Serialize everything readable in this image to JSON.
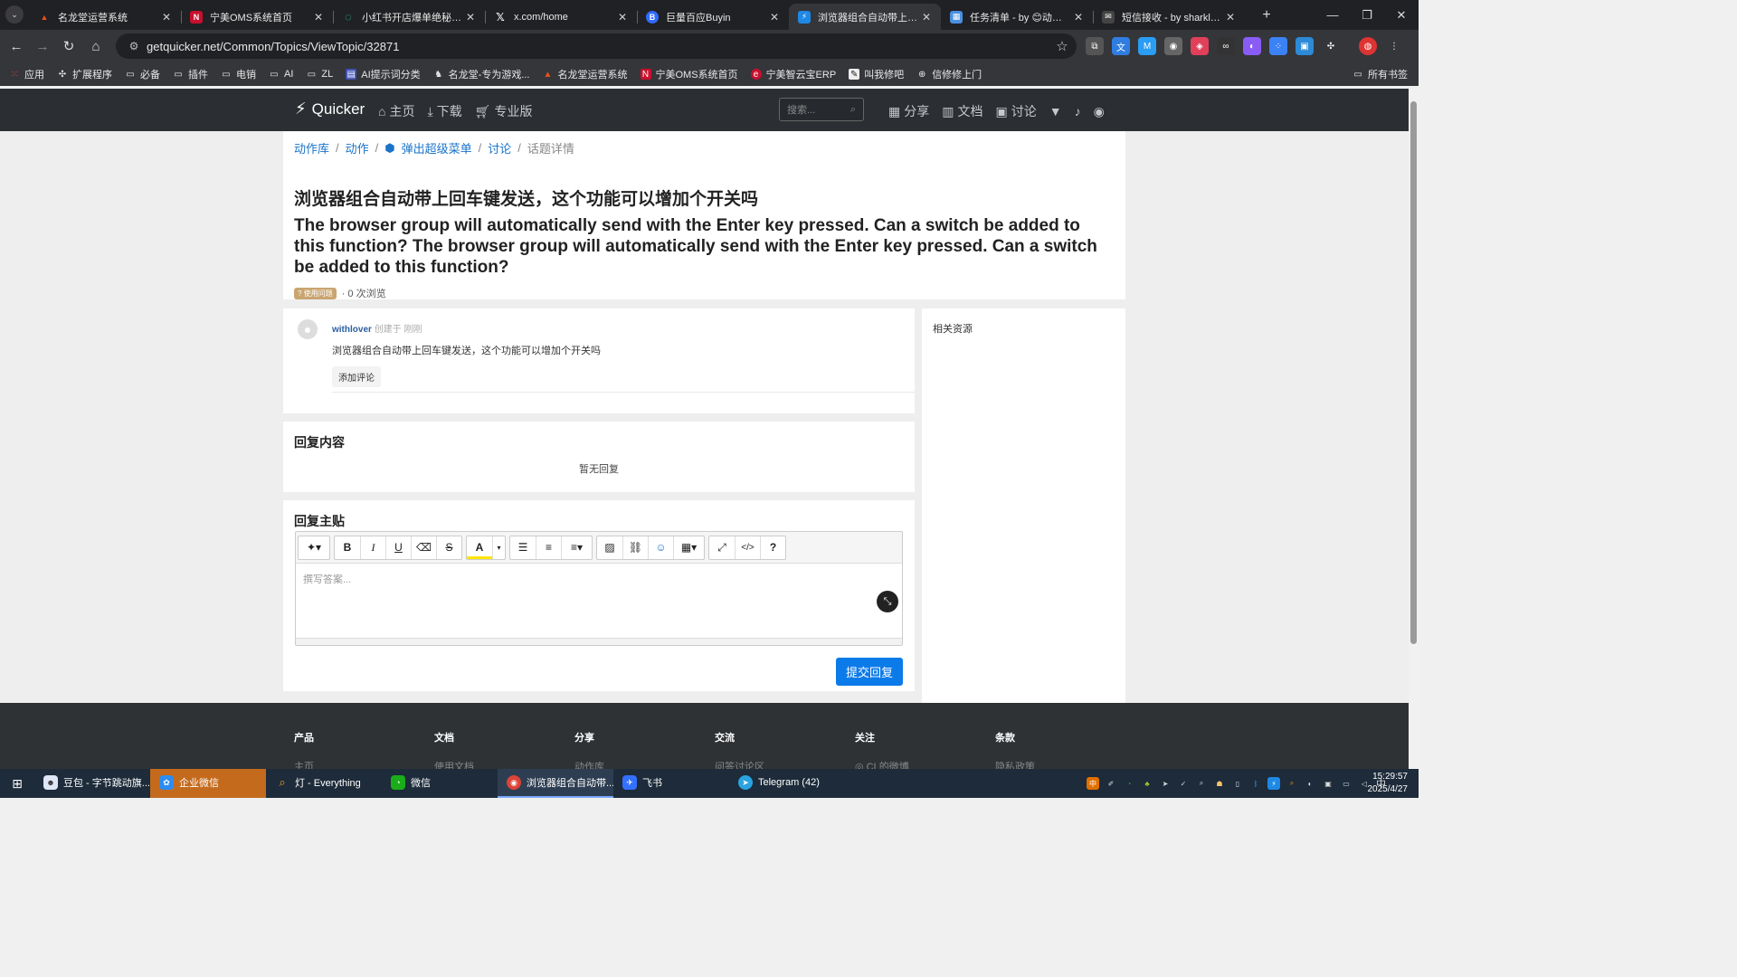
{
  "browser": {
    "tabs": [
      {
        "title": "名龙堂运营系统",
        "favicon": "flame-icon",
        "color": "#e8501a"
      },
      {
        "title": "宁美OMS系统首页",
        "favicon": "n-logo-icon",
        "color": "#c8102e"
      },
      {
        "title": "小红书开店爆单绝秘籍-知",
        "favicon": "loading-icon",
        "color": "#20c997"
      },
      {
        "title": "x.com/home",
        "favicon": "x-logo-icon",
        "color": "#000000"
      },
      {
        "title": "巨量百应Buyin",
        "favicon": "b-logo-icon",
        "color": "#2f6bff"
      },
      {
        "title": "浏览器组合自动带上回车",
        "favicon": "quicker-icon",
        "color": "#1e88e5",
        "active": true
      },
      {
        "title": "任务清单 - by 😊动作免",
        "favicon": "calendar-icon",
        "color": "#4a90e2"
      },
      {
        "title": "短信接收 - by sharklaka",
        "favicon": "message-icon",
        "color": "#444444"
      }
    ],
    "url": "getquicker.net/Common/Topics/ViewTopic/32871",
    "bookmarks": [
      {
        "label": "应用",
        "icon": "apps-grid-icon"
      },
      {
        "label": "扩展程序",
        "icon": "puzzle-icon"
      },
      {
        "label": "必备",
        "icon": "folder-icon"
      },
      {
        "label": "插件",
        "icon": "folder-icon"
      },
      {
        "label": "电销",
        "icon": "folder-icon"
      },
      {
        "label": "AI",
        "icon": "folder-icon"
      },
      {
        "label": "ZL",
        "icon": "folder-icon"
      },
      {
        "label": "AI提示词分类",
        "icon": "doc-icon"
      },
      {
        "label": "名龙堂-专为游戏...",
        "icon": "dragon-icon"
      },
      {
        "label": "名龙堂运营系统",
        "icon": "flame-icon"
      },
      {
        "label": "宁美OMS系统首页",
        "icon": "n-logo-icon"
      },
      {
        "label": "宁美智云宝ERP",
        "icon": "erp-icon"
      },
      {
        "label": "叫我修吧",
        "icon": "wrench-icon"
      },
      {
        "label": "信修修上门",
        "icon": "globe-icon"
      }
    ],
    "bookmarks_all": "所有书签"
  },
  "site": {
    "logo": "Quicker",
    "nav": [
      "主页",
      "下载",
      "专业版"
    ],
    "search_placeholder": "搜索...",
    "nav_right": [
      "分享",
      "文档",
      "讨论"
    ]
  },
  "breadcrumb": [
    "动作库",
    "动作",
    "弹出超级菜单",
    "讨论",
    "话题详情"
  ],
  "topic": {
    "title_cn": "浏览器组合自动带上回车键发送，这个功能可以增加个开关吗",
    "title_en": "The browser group will automatically send with the Enter key pressed. Can a switch be added to this function? The browser group will automatically send with the Enter key pressed. Can a switch be added to this function?",
    "tag": "使用问题",
    "views": "· 0 次浏览"
  },
  "post": {
    "author": "withlover",
    "created": "创建于 刚刚",
    "content": "浏览器组合自动带上回车键发送，这个功能可以增加个开关吗",
    "add_comment": "添加评论"
  },
  "replies": {
    "heading": "回复内容",
    "empty": "暂无回复"
  },
  "reply_form": {
    "heading": "回复主贴",
    "placeholder": "撰写答案...",
    "submit": "提交回复"
  },
  "sidebar": {
    "heading": "相关资源"
  },
  "footer": {
    "columns": [
      {
        "title": "产品",
        "first": "主页"
      },
      {
        "title": "文档",
        "first": "使用文档"
      },
      {
        "title": "分享",
        "first": "动作库"
      },
      {
        "title": "交流",
        "first": "问答讨论区"
      },
      {
        "title": "关注",
        "first": "CL的微博"
      },
      {
        "title": "条款",
        "first": "隐私政策"
      }
    ]
  },
  "taskbar": {
    "items": [
      {
        "label": "豆包 - 字节跳动旗...",
        "icon": "doubao-icon"
      },
      {
        "label": "企业微信",
        "icon": "wecom-icon",
        "highlight": true
      },
      {
        "label": "灯 - Everything",
        "icon": "everything-search-icon"
      },
      {
        "label": "微信",
        "icon": "wechat-icon"
      },
      {
        "label": "浏览器组合自动带...",
        "icon": "chrome-icon",
        "active": true
      },
      {
        "label": "飞书",
        "icon": "feishu-icon"
      },
      {
        "label": "Telegram (42)",
        "icon": "telegram-icon"
      }
    ],
    "ime": "中",
    "time": "15:29:57",
    "date": "2025/4/27"
  },
  "colors": {
    "link": "#1a73c9",
    "submit": "#0c7bea",
    "header_bg": "#2b2f33",
    "tag_bg": "#c9a571"
  }
}
